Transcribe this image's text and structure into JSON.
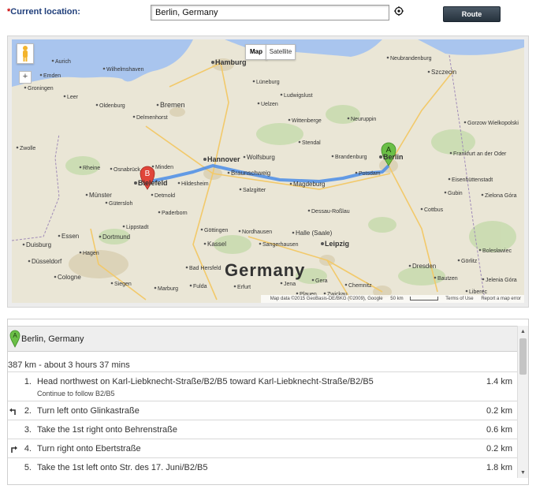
{
  "top": {
    "required_marker": "*",
    "location_label": "Current location:",
    "location_value": "Berlin, Germany",
    "route_button": "Route"
  },
  "map": {
    "type_map": "Map",
    "type_satellite": "Satellite",
    "zoom_in": "+",
    "attribution": "Map data ©2015 GeoBasis-DE/BKG (©2009), Google",
    "scale": "50 km",
    "terms": "Terms of Use",
    "report": "Report a map error",
    "marker_a": "A",
    "marker_b": "B",
    "country_label": "Germany",
    "cities": [
      "Hamburg",
      "Bremen",
      "Hannover",
      "Wolfsburg",
      "Braunschweig",
      "Magdeburg",
      "Berlin",
      "Potsdam",
      "Bielefeld",
      "Münster",
      "Dortmund",
      "Essen",
      "Duisburg",
      "Düsseldorf",
      "Cologne",
      "Kassel",
      "Göttingen",
      "Leipzig",
      "Halle (Saale)",
      "Dresden",
      "Chemnitz",
      "Gera",
      "Jena",
      "Erfurt",
      "Bad Hersfeld",
      "Paderborn",
      "Detmold",
      "Minden",
      "Osnabrück",
      "Oldenburg",
      "Wilhelmshaven",
      "Groningen",
      "Lüneburg",
      "Uelzen",
      "Stendal",
      "Brandenburg",
      "Neuruppin",
      "Neubrandenburg",
      "Szczecin",
      "Gorzow Wielkopolski",
      "Frankfurt an der Oder",
      "Eisenhüttenstadt",
      "Cottbus",
      "Salzgitter",
      "Hildesheim",
      "Nordhausen",
      "Dessau-Roßlau",
      "Sangerhausen",
      "Lippstadt",
      "Gütersloh",
      "Delmenhorst",
      "Emden",
      "Leer",
      "Aurich",
      "Wittenberge",
      "Ludwigslust",
      "Zwolle",
      "Rheine",
      "Gubin",
      "Zielona Góra",
      "Görlitz",
      "Liberec",
      "Jelenia Góra",
      "Bolesławiec",
      "Hagen",
      "Siegen",
      "Marburg",
      "Fulda",
      "Zwickau",
      "Plauen",
      "Bautzen"
    ]
  },
  "directions": {
    "start_marker": "A",
    "start_address": "Berlin, Germany",
    "summary": "387 km - about 3 hours 37 mins",
    "steps": [
      {
        "num": "1.",
        "text": "Head northwest on Karl-Liebknecht-Straße/B2/B5 toward Karl-Liebknecht-Straße/B2/B5",
        "sub": "Continue to follow B2/B5",
        "dist": "1.4 km",
        "turn": ""
      },
      {
        "num": "2.",
        "text": "Turn left onto Glinkastraße",
        "sub": "",
        "dist": "0.2 km",
        "turn": "turn-left-icon"
      },
      {
        "num": "3.",
        "text": "Take the 1st right onto Behrenstraße",
        "sub": "",
        "dist": "0.6 km",
        "turn": ""
      },
      {
        "num": "4.",
        "text": "Turn right onto Ebertstraße",
        "sub": "",
        "dist": "0.2 km",
        "turn": "turn-right-icon"
      },
      {
        "num": "5.",
        "text": "Take the 1st left onto Str. des 17. Juni/B2/B5",
        "sub": "",
        "dist": "1.8 km",
        "turn": ""
      }
    ]
  },
  "colors": {
    "route": "#4a8ce8",
    "marker_a": "#6bbf47",
    "marker_b": "#e0453a",
    "label_blue": "#1f3e7a",
    "required_red": "#cc0000"
  }
}
